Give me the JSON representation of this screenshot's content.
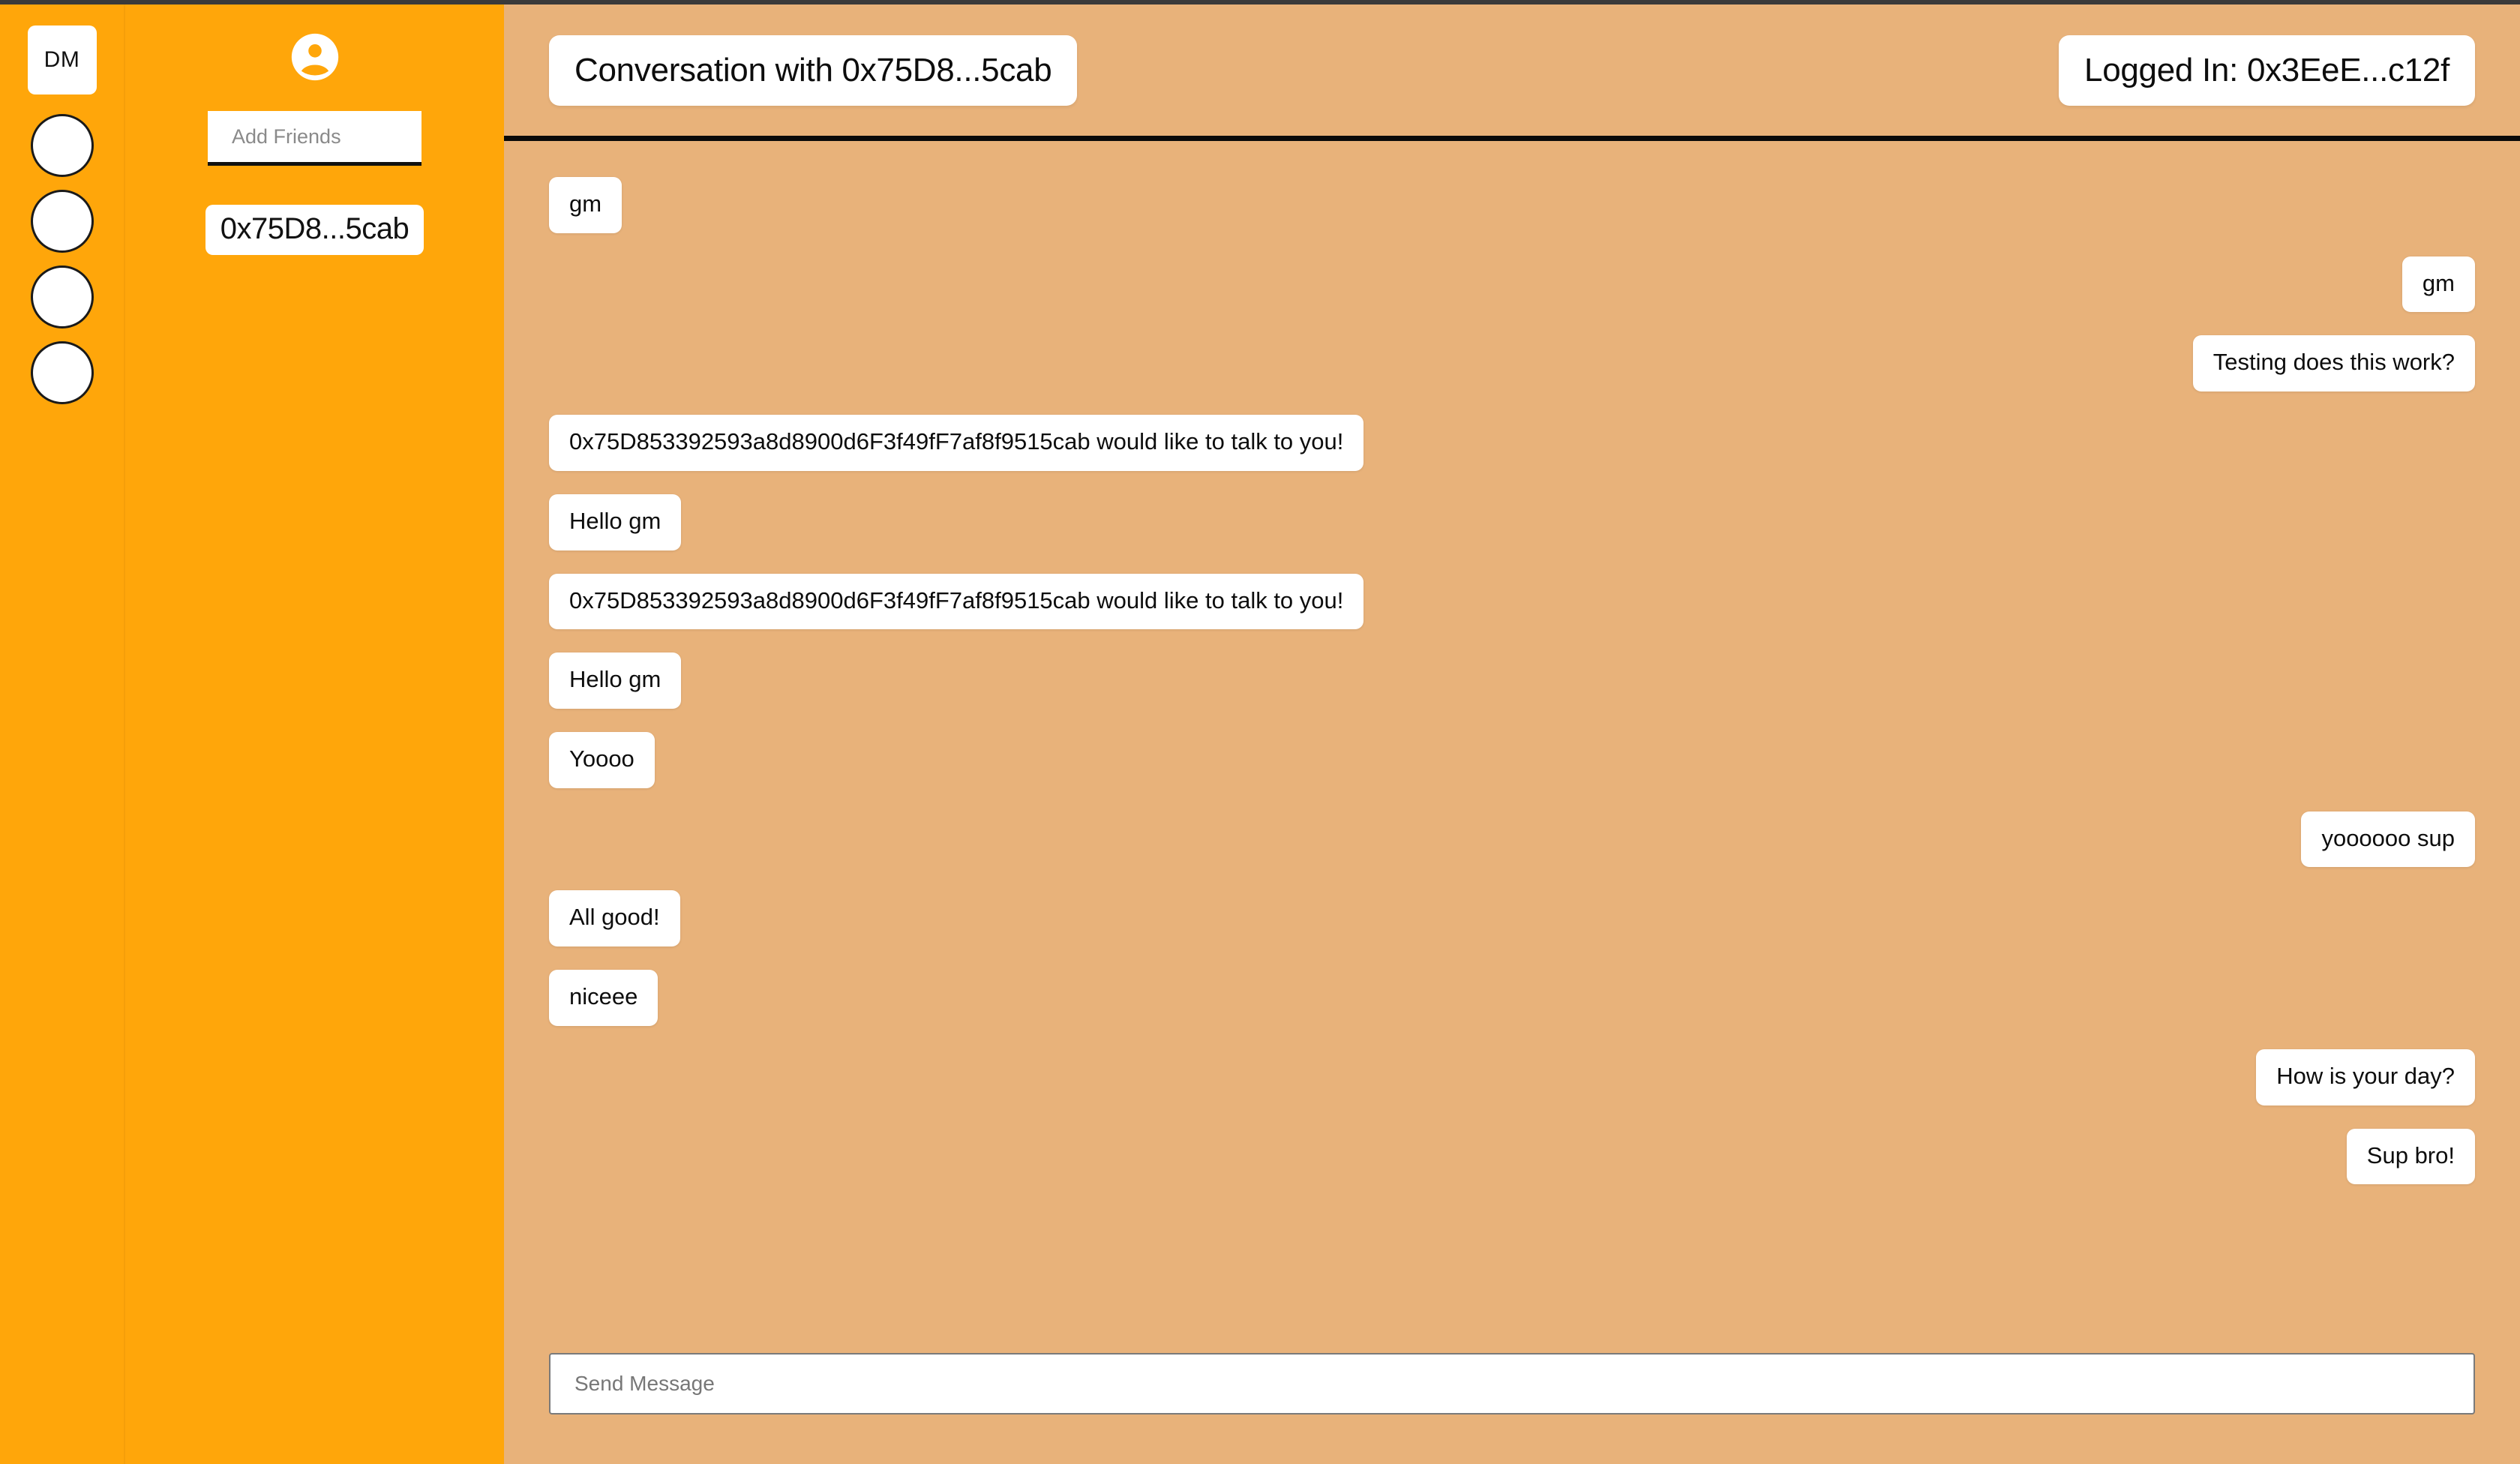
{
  "colors": {
    "sidebar": "#FFA60A",
    "chat_background": "#E8B27A",
    "bubble": "#FFFFFF",
    "divider": "#0A0A0A"
  },
  "rail": {
    "dm_label": "DM",
    "server_circles": [
      "",
      "",
      "",
      ""
    ]
  },
  "sidebar": {
    "account_icon": "account-circle-icon",
    "add_friends": {
      "value": "",
      "placeholder": "Add Friends"
    },
    "friends": [
      {
        "label": "0x75D8...5cab"
      }
    ]
  },
  "header": {
    "conversation_title": "Conversation with 0x75D8...5cab",
    "logged_in": "Logged In: 0x3EeE...c12f"
  },
  "messages": [
    {
      "side": "left",
      "text": "gm"
    },
    {
      "side": "right",
      "text": "gm"
    },
    {
      "side": "right",
      "text": "Testing does this work?"
    },
    {
      "side": "left",
      "text": "0x75D853392593a8d8900d6F3f49fF7af8f9515cab would like to talk to you!"
    },
    {
      "side": "left",
      "text": "Hello gm"
    },
    {
      "side": "left",
      "text": "0x75D853392593a8d8900d6F3f49fF7af8f9515cab would like to talk to you!"
    },
    {
      "side": "left",
      "text": "Hello gm"
    },
    {
      "side": "left",
      "text": "Yoooo"
    },
    {
      "side": "right",
      "text": "yoooooo sup"
    },
    {
      "side": "left",
      "text": "All good!"
    },
    {
      "side": "left",
      "text": "niceee"
    },
    {
      "side": "right",
      "text": "How is your day?"
    },
    {
      "side": "right",
      "text": "Sup bro!"
    }
  ],
  "composer": {
    "value": "",
    "placeholder": "Send Message"
  }
}
